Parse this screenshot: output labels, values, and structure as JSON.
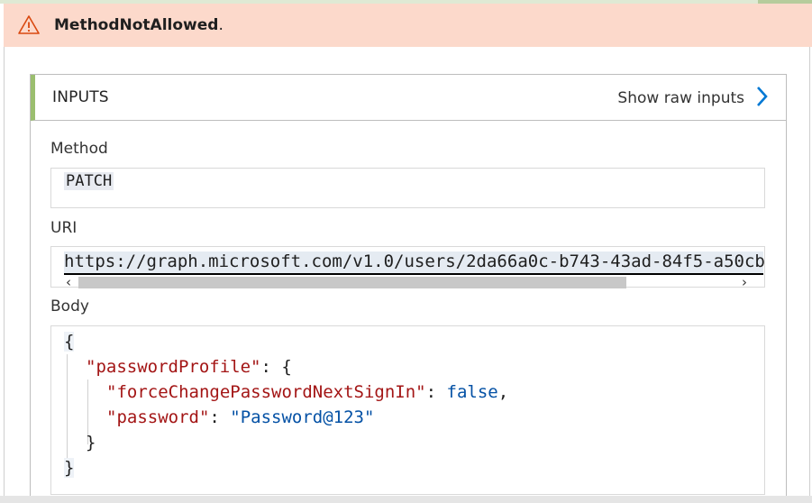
{
  "error": {
    "title": "MethodNotAllowed",
    "suffix": ".",
    "icon": "warning-icon"
  },
  "inputs": {
    "title": "INPUTS",
    "show_raw_label": "Show raw inputs",
    "show_raw_icon": "chevron-right-icon",
    "method": {
      "label": "Method",
      "value": "PATCH"
    },
    "uri": {
      "label": "URI",
      "value": "https://graph.microsoft.com/v1.0/users/2da66a0c-b743-43ad-84f5-a50cb"
    },
    "body": {
      "label": "Body",
      "line1": "{",
      "line2_key": "\"passwordProfile\"",
      "line2_rest": ": {",
      "line3_key": "\"forceChangePasswordNextSignIn\"",
      "line3_sep": ": ",
      "line3_value": "false",
      "line3_end": ",",
      "line4_key": "\"password\"",
      "line4_sep": ": ",
      "line4_value": "\"Password@123\"",
      "line5": "}",
      "line6": "}"
    }
  },
  "colors": {
    "error_bg": "#fcd9cb",
    "accent": "#9bbe6f",
    "link": "#0078d4",
    "json_key": "#a31515",
    "json_value": "#0451a5"
  }
}
